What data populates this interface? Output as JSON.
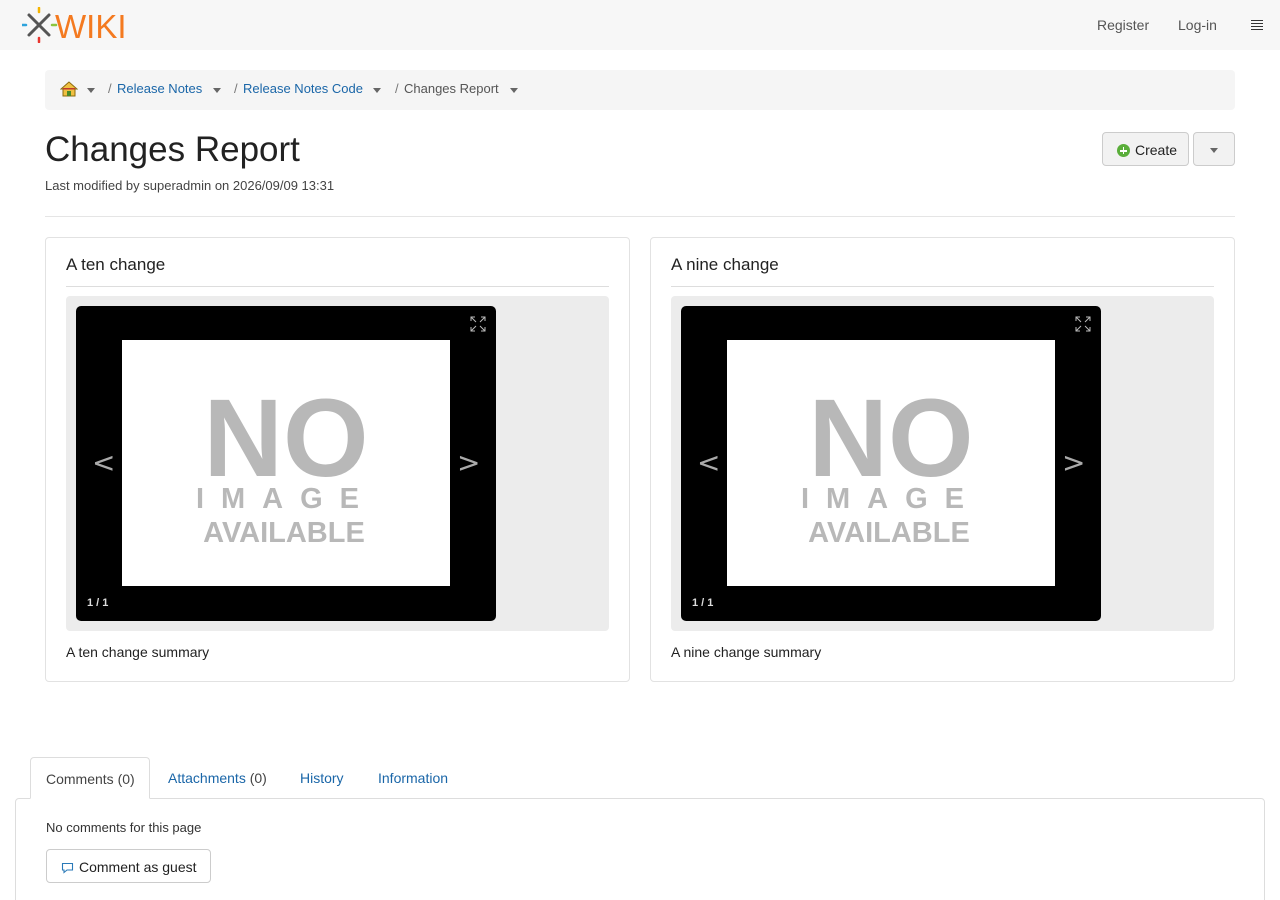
{
  "header": {
    "logo_text": "XWIKI",
    "register_label": "Register",
    "login_label": "Log-in"
  },
  "breadcrumb": {
    "separator": "/",
    "items": [
      {
        "label": "Release Notes"
      },
      {
        "label": "Release Notes Code"
      }
    ],
    "current": "Changes Report"
  },
  "page": {
    "title": "Changes Report",
    "meta": "Last modified by superadmin on 2026/09/09 13:31",
    "create_label": "Create"
  },
  "changes": [
    {
      "title": "A ten change",
      "placeholder": {
        "line1": "NO",
        "line2": "IMAGE",
        "line3": "AVAILABLE"
      },
      "prev": "<",
      "next": ">",
      "counter": "1 / 1",
      "summary": "A ten change summary"
    },
    {
      "title": "A nine change",
      "placeholder": {
        "line1": "NO",
        "line2": "IMAGE",
        "line3": "AVAILABLE"
      },
      "prev": "<",
      "next": ">",
      "counter": "1 / 1",
      "summary": "A nine change summary"
    }
  ],
  "tabs": [
    {
      "label": "Comments",
      "count": "(0)"
    },
    {
      "label": "Attachments",
      "count": "(0)"
    },
    {
      "label": "History"
    },
    {
      "label": "Information"
    }
  ],
  "comments": {
    "empty_text": "No comments for this page",
    "button_label": "Comment as guest"
  },
  "colors": {
    "link": "#1a66a8",
    "logo_orange": "#f47a20",
    "create_green": "#5aae3a"
  }
}
